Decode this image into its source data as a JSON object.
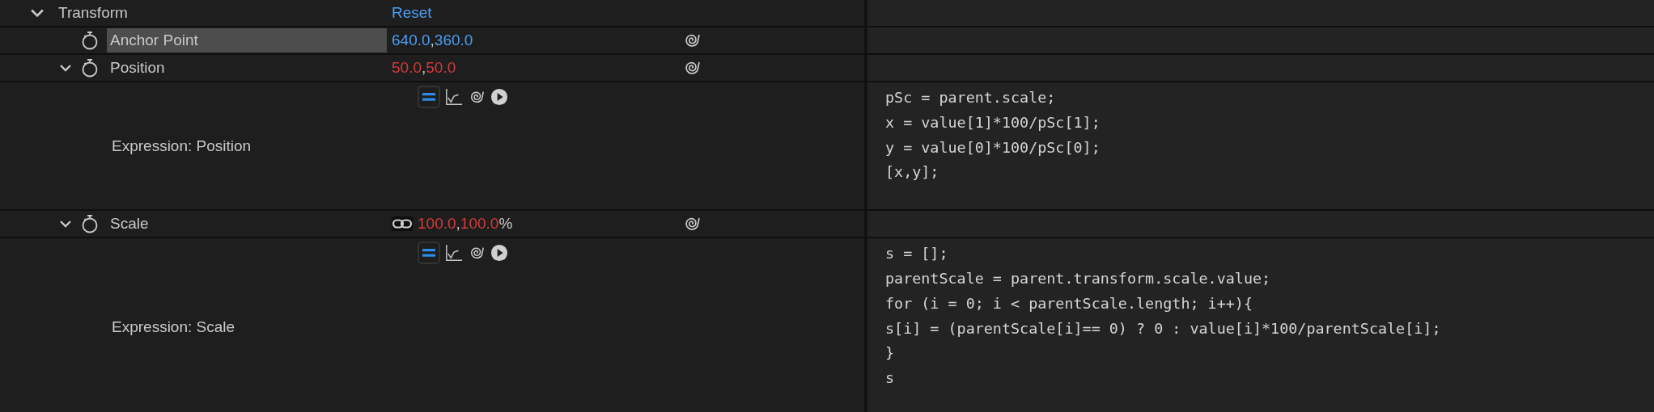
{
  "group": {
    "label": "Transform",
    "expanded": true,
    "reset": "Reset"
  },
  "properties": [
    {
      "name": "Anchor Point",
      "selected": true,
      "expression_driven": false,
      "values": [
        "640.0",
        "360.0"
      ],
      "separator": ","
    },
    {
      "name": "Position",
      "selected": false,
      "expanded": true,
      "expression_driven": true,
      "values": [
        "50.0",
        "50.0"
      ],
      "separator": ",",
      "expression": {
        "label": "Expression: Position",
        "enabled": true,
        "code": [
          "pSc = parent.scale;",
          "x = value[1]*100/pSc[1];",
          "y = value[0]*100/pSc[0];",
          "[x,y];"
        ]
      }
    },
    {
      "name": "Scale",
      "selected": false,
      "expanded": true,
      "linked": true,
      "expression_driven": true,
      "values": [
        "100.0",
        "100.0"
      ],
      "separator": ",",
      "unit": "%",
      "expression": {
        "label": "Expression: Scale",
        "enabled": true,
        "code": [
          "s = [];",
          "parentScale = parent.transform.scale.value;",
          "for (i = 0; i < parentScale.length; i++){",
          "s[i] = (parentScale[i]== 0) ? 0 : value[i]*100/parentScale[i];",
          "}",
          "s"
        ]
      }
    }
  ]
}
